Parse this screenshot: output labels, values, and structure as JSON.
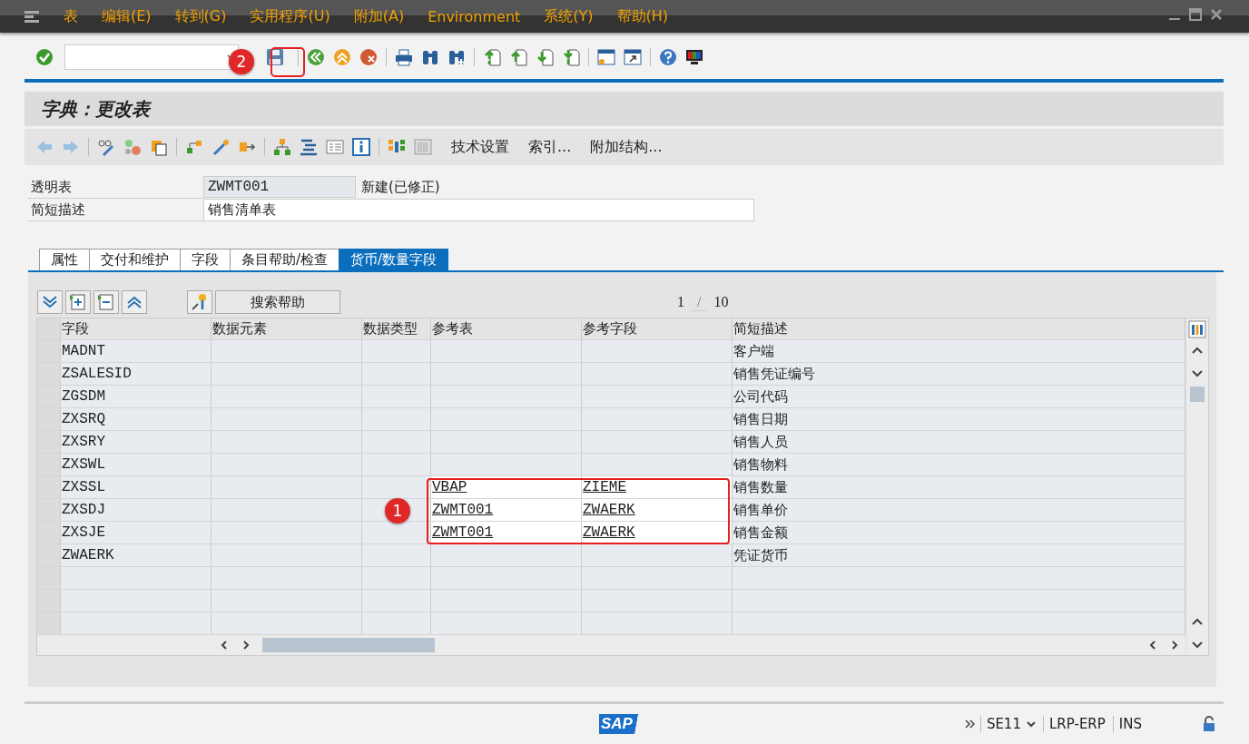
{
  "menu_bar": {
    "items": [
      "表",
      "编辑(E)",
      "转到(G)",
      "实用程序(U)",
      "附加(A)",
      "Environment",
      "系统(Y)",
      "帮助(H)"
    ]
  },
  "title": "字典：更改表",
  "app_toolbar": {
    "text_buttons": [
      "技术设置",
      "索引...",
      "附加结构..."
    ]
  },
  "header_fields": [
    {
      "label": "透明表",
      "value": "ZWMT001",
      "readonly": true,
      "status": "新建(已修正)"
    },
    {
      "label": "简短描述",
      "value": "销售清单表",
      "readonly": false
    }
  ],
  "tabs": [
    {
      "label": "属性",
      "selected": false
    },
    {
      "label": "交付和维护",
      "selected": false
    },
    {
      "label": "字段",
      "selected": false
    },
    {
      "label": "条目帮助/检查",
      "selected": false
    },
    {
      "label": "货币/数量字段",
      "selected": true
    }
  ],
  "table_toolbar": {
    "button": "搜索帮助",
    "page": {
      "current": "1",
      "separator": "/",
      "total": "10"
    }
  },
  "table": {
    "columns": [
      "字段",
      "数据元素",
      "数据类型",
      "参考表",
      "参考字段",
      "简短描述"
    ],
    "rows": [
      {
        "field": "MADNT",
        "description": "客户端",
        "input_ready": false
      },
      {
        "field": "ZSALESID",
        "description": "销售凭证编号",
        "input_ready": false
      },
      {
        "field": "ZGSDM",
        "description": "公司代码",
        "input_ready": false
      },
      {
        "field": "ZXSRQ",
        "description": "销售日期",
        "input_ready": false
      },
      {
        "field": "ZXSRY",
        "description": "销售人员",
        "input_ready": false
      },
      {
        "field": "ZXSWL",
        "description": "销售物料",
        "input_ready": false
      },
      {
        "field": "ZXSSL",
        "ref_table": "VBAP",
        "ref_field": "ZIEME",
        "description": "销售数量",
        "input_ready": true
      },
      {
        "field": "ZXSDJ",
        "ref_table": "ZWMT001",
        "ref_field": "ZWAERK",
        "description": "销售单价",
        "input_ready": true
      },
      {
        "field": "ZXSJE",
        "ref_table": "ZWMT001",
        "ref_field": "ZWAERK",
        "description": "销售金额",
        "input_ready": true
      },
      {
        "field": "ZWAERK",
        "description": "凭证货币",
        "input_ready": false
      }
    ]
  },
  "status_bar": {
    "logo": "SAP",
    "transaction": "SE11",
    "system": "LRP-ERP",
    "mode": "INS"
  },
  "annotations": [
    {
      "kind": "save",
      "label": "2"
    },
    {
      "kind": "table",
      "label": "1"
    }
  ]
}
